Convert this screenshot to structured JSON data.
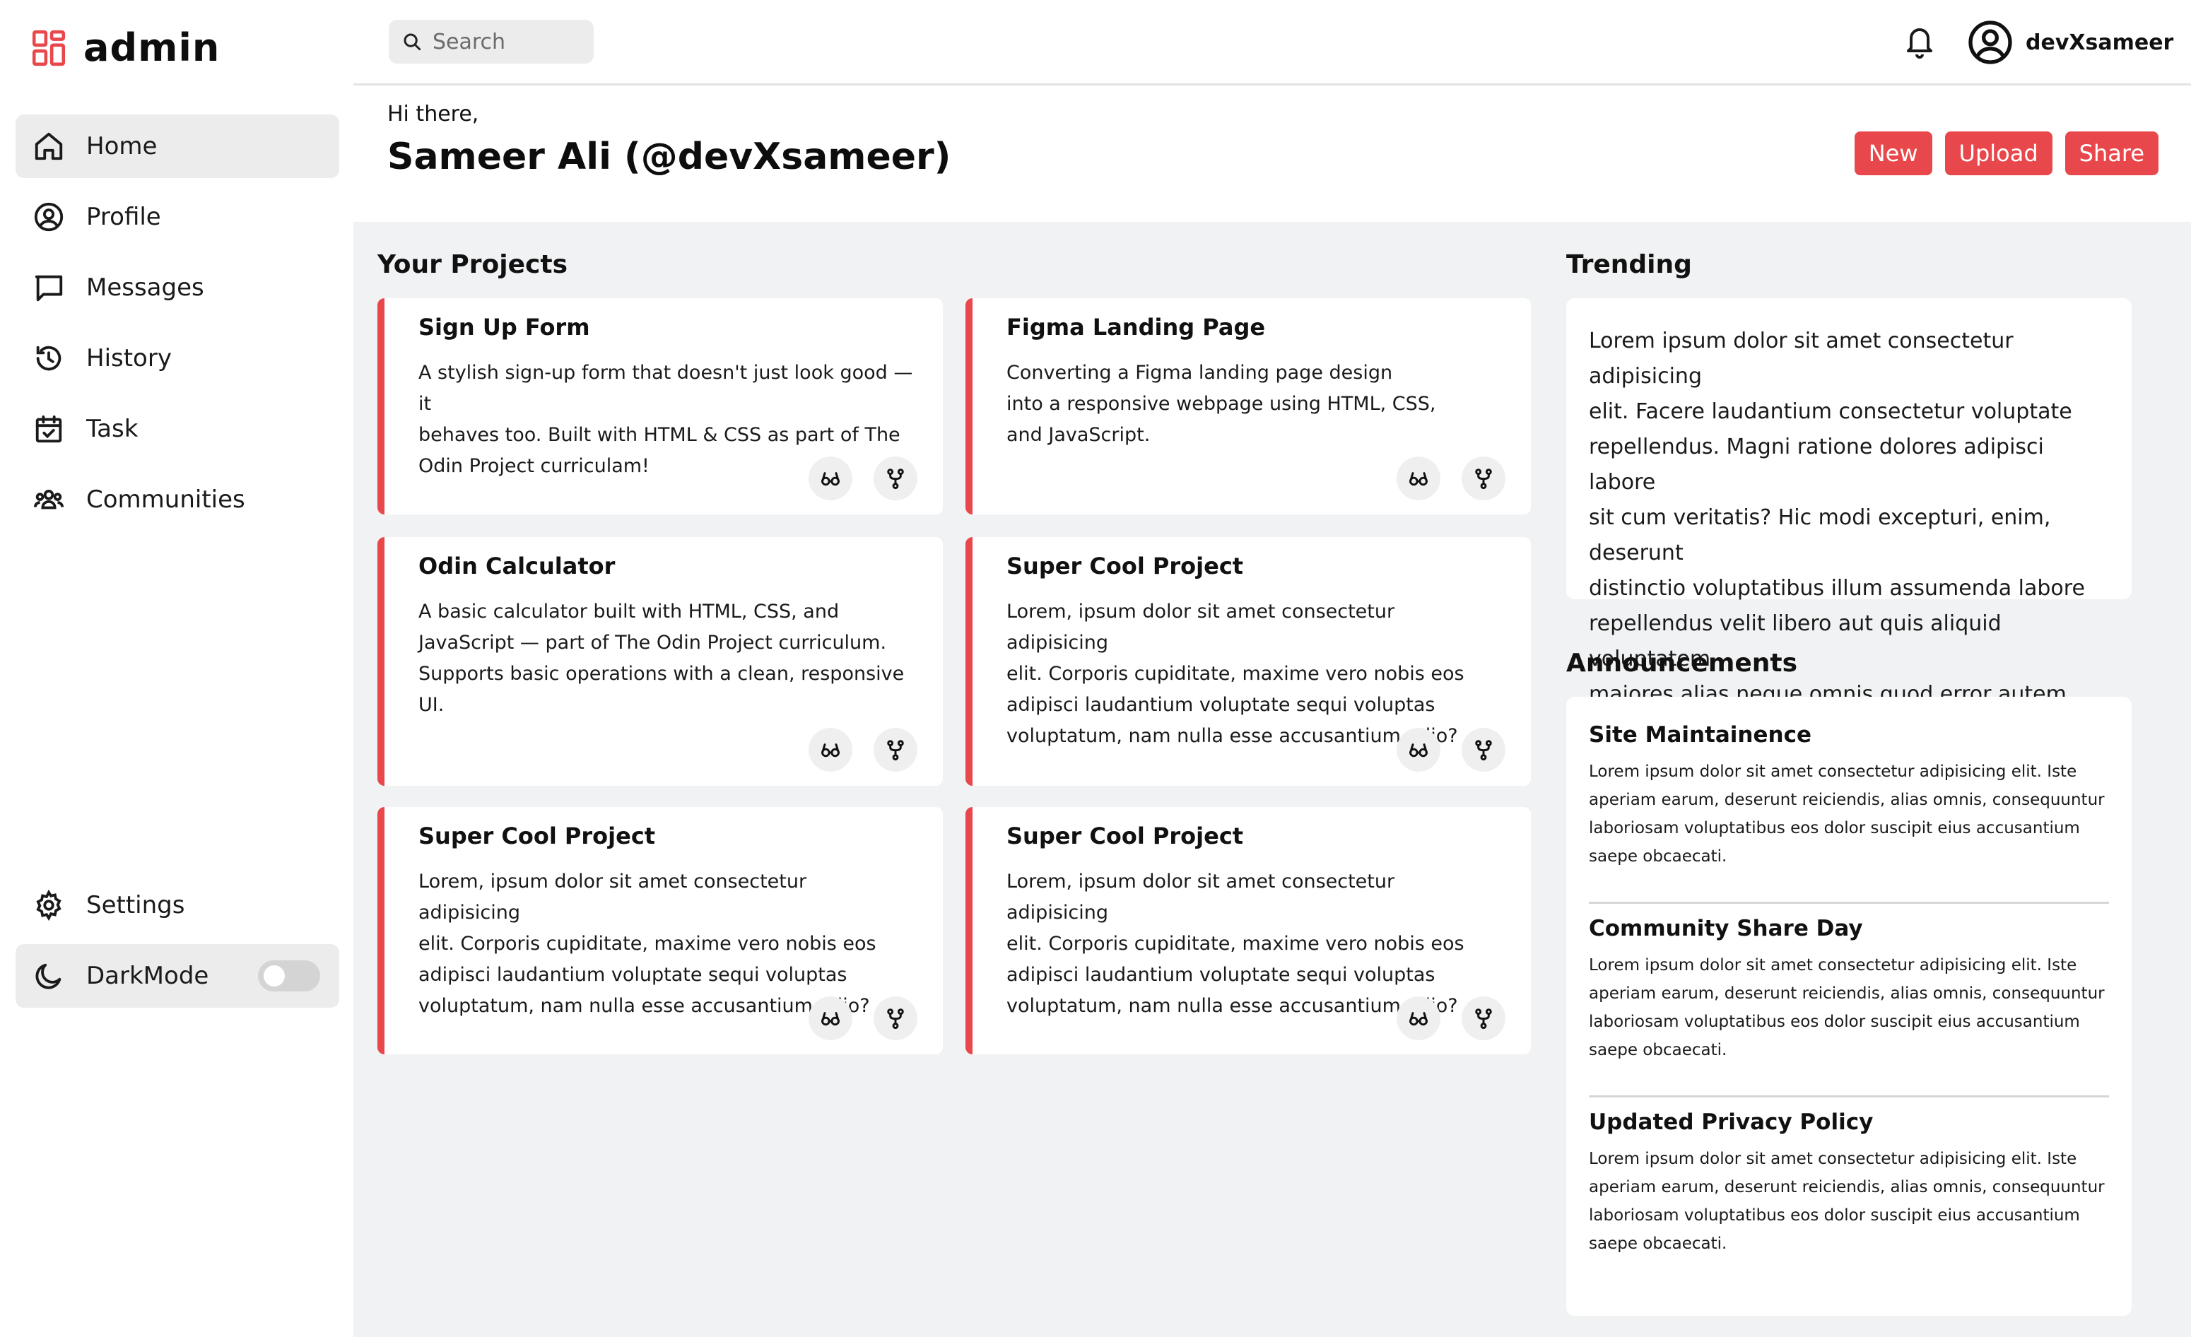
{
  "brand": {
    "name": "admin",
    "accent_color": "#e8474b"
  },
  "sidebar": {
    "items": [
      {
        "label": "Home",
        "icon": "home-icon",
        "active": true
      },
      {
        "label": "Profile",
        "icon": "user-circle-icon"
      },
      {
        "label": "Messages",
        "icon": "message-icon"
      },
      {
        "label": "History",
        "icon": "history-icon"
      },
      {
        "label": "Task",
        "icon": "calendar-check-icon"
      },
      {
        "label": "Communities",
        "icon": "users-icon"
      }
    ],
    "bottom": [
      {
        "label": "Settings",
        "icon": "gear-icon"
      },
      {
        "label": "DarkMode",
        "icon": "moon-icon",
        "toggle_on": false
      }
    ]
  },
  "topbar": {
    "search_placeholder": "Search",
    "username": "devXsameer"
  },
  "greeting": {
    "hi": "Hi there,",
    "name": "Sameer Ali (@devXsameer)",
    "buttons": [
      "New",
      "Upload",
      "Share"
    ]
  },
  "projects": {
    "title": "Your Projects",
    "items": [
      {
        "title": "Sign Up Form",
        "lines": [
          "A stylish sign-up form that doesn't just look good — it",
          "behaves too. Built with HTML & CSS as part of The",
          "Odin Project curriculam!"
        ]
      },
      {
        "title": "Figma Landing Page",
        "lines": [
          "Converting a Figma landing page design",
          "into a responsive webpage using HTML, CSS,",
          "and JavaScript."
        ]
      },
      {
        "title": "Odin Calculator",
        "lines": [
          "A basic calculator built with HTML, CSS, and",
          "JavaScript — part of The Odin Project curriculum.",
          "Supports basic operations with a clean, responsive UI."
        ]
      },
      {
        "title": "Super Cool Project",
        "lines": [
          "Lorem, ipsum dolor sit amet consectetur adipisicing",
          "elit. Corporis cupiditate, maxime vero nobis eos",
          "adipisci laudantium voluptate sequi voluptas",
          "voluptatum, nam nulla esse accusantium odio?"
        ]
      },
      {
        "title": "Super Cool Project",
        "lines": [
          "Lorem, ipsum dolor sit amet consectetur adipisicing",
          "elit. Corporis cupiditate, maxime vero nobis eos",
          "adipisci laudantium voluptate sequi voluptas",
          "voluptatum, nam nulla esse accusantium odio?"
        ]
      },
      {
        "title": "Super Cool Project",
        "lines": [
          "Lorem, ipsum dolor sit amet consectetur adipisicing",
          "elit. Corporis cupiditate, maxime vero nobis eos",
          "adipisci laudantium voluptate sequi voluptas",
          "voluptatum, nam nulla esse accusantium odio?"
        ]
      }
    ],
    "card_icons": [
      "glasses-icon",
      "fork-icon"
    ]
  },
  "trending": {
    "title": "Trending",
    "lines": [
      "Lorem ipsum dolor sit amet consectetur adipisicing",
      "elit. Facere laudantium consectetur voluptate",
      "repellendus. Magni ratione dolores adipisci labore",
      "sit cum veritatis? Hic modi excepturi, enim, deserunt",
      "distinctio voluptatibus illum assumenda labore",
      "repellendus velit libero aut quis aliquid voluptatem",
      "maiores alias neque omnis quod error autem."
    ]
  },
  "announcements": {
    "title": "Announcements",
    "items": [
      {
        "title": "Site Maintainence",
        "lines": [
          "Lorem ipsum dolor sit amet consectetur adipisicing elit. Iste",
          "aperiam earum, deserunt reiciendis, alias omnis, consequuntur",
          "laboriosam voluptatibus eos dolor suscipit eius accusantium",
          "saepe obcaecati."
        ]
      },
      {
        "title": "Community Share Day",
        "lines": [
          "Lorem ipsum dolor sit amet consectetur adipisicing elit. Iste",
          "aperiam earum, deserunt reiciendis, alias omnis, consequuntur",
          "laboriosam voluptatibus eos dolor suscipit eius accusantium",
          "saepe obcaecati."
        ]
      },
      {
        "title": "Updated Privacy Policy",
        "lines": [
          "Lorem ipsum dolor sit amet consectetur adipisicing elit. Iste",
          "aperiam earum, deserunt reiciendis, alias omnis, consequuntur",
          "laboriosam voluptatibus eos dolor suscipit eius accusantium",
          "saepe obcaecati."
        ]
      }
    ]
  }
}
